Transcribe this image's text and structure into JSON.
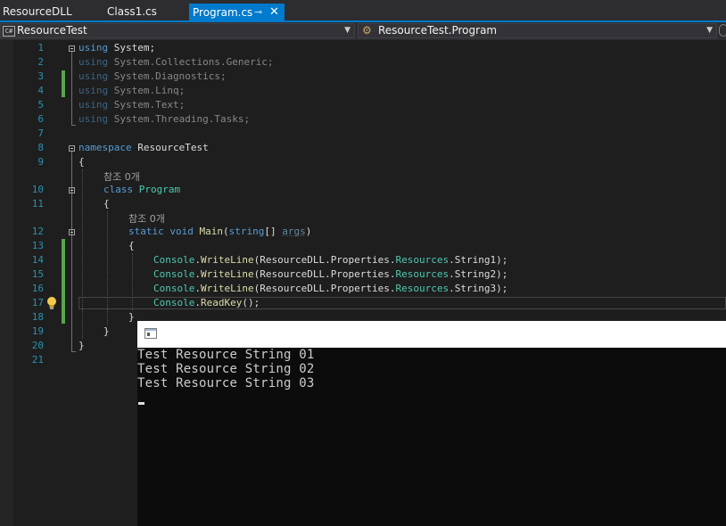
{
  "tabs": [
    {
      "label": "ResourceDLL",
      "active": false
    },
    {
      "label": "Class1.cs",
      "active": false
    },
    {
      "label": "Program.cs",
      "active": true
    }
  ],
  "tab_icons": {
    "pin": "⊸",
    "close": "✕"
  },
  "navbar": {
    "project": "ResourceTest",
    "project_icon": "C#",
    "member": "ResourceTest.Program"
  },
  "line_numbers": [
    "1",
    "2",
    "3",
    "4",
    "5",
    "6",
    "7",
    "8",
    "9",
    "10",
    "11",
    "12",
    "13",
    "14",
    "15",
    "16",
    "17",
    "18",
    "19",
    "20",
    "21"
  ],
  "code": {
    "l1": {
      "kw": "using",
      "rest": " System;"
    },
    "l2": {
      "kw": "using",
      "rest": " System.Collections.Generic;"
    },
    "l3": {
      "kw": "using",
      "rest": " System.Diagnostics;"
    },
    "l4": {
      "kw": "using",
      "rest": " System.Linq;"
    },
    "l5": {
      "kw": "using",
      "rest": " System.Text;"
    },
    "l6": {
      "kw": "using",
      "rest": " System.Threading.Tasks;"
    },
    "l8": {
      "kw": "namespace",
      "rest": " ResourceTest"
    },
    "brace_open": "{",
    "brace_close": "}",
    "codelens": "참조 0개",
    "l10": {
      "kw": "class",
      "name": "Program"
    },
    "l12": {
      "kw1": "static",
      "kw2": "void",
      "method": "Main",
      "p_open": "(",
      "type": "string",
      "arr": "[] ",
      "arg": "args",
      "p_close": ")"
    },
    "console": "Console",
    "dot": ".",
    "writeline": "WriteLine",
    "open": "(",
    "prefix": "ResourceDLL.Properties.",
    "resources": "Resources",
    "l14_end": ".String1);",
    "l15_end": ".String2);",
    "l16_end": ".String3);",
    "readkey": "ReadKey",
    "readkey_end": "();"
  },
  "console_output": [
    "Test Resource String 01",
    "Test Resource String 02",
    "Test Resource String 03"
  ],
  "colors": {
    "accent": "#007acc",
    "keyword": "#569cd6",
    "type": "#4ec9b0",
    "method": "#dcdcaa",
    "line_number": "#2b91af",
    "changed_margin": "#57a64a"
  }
}
